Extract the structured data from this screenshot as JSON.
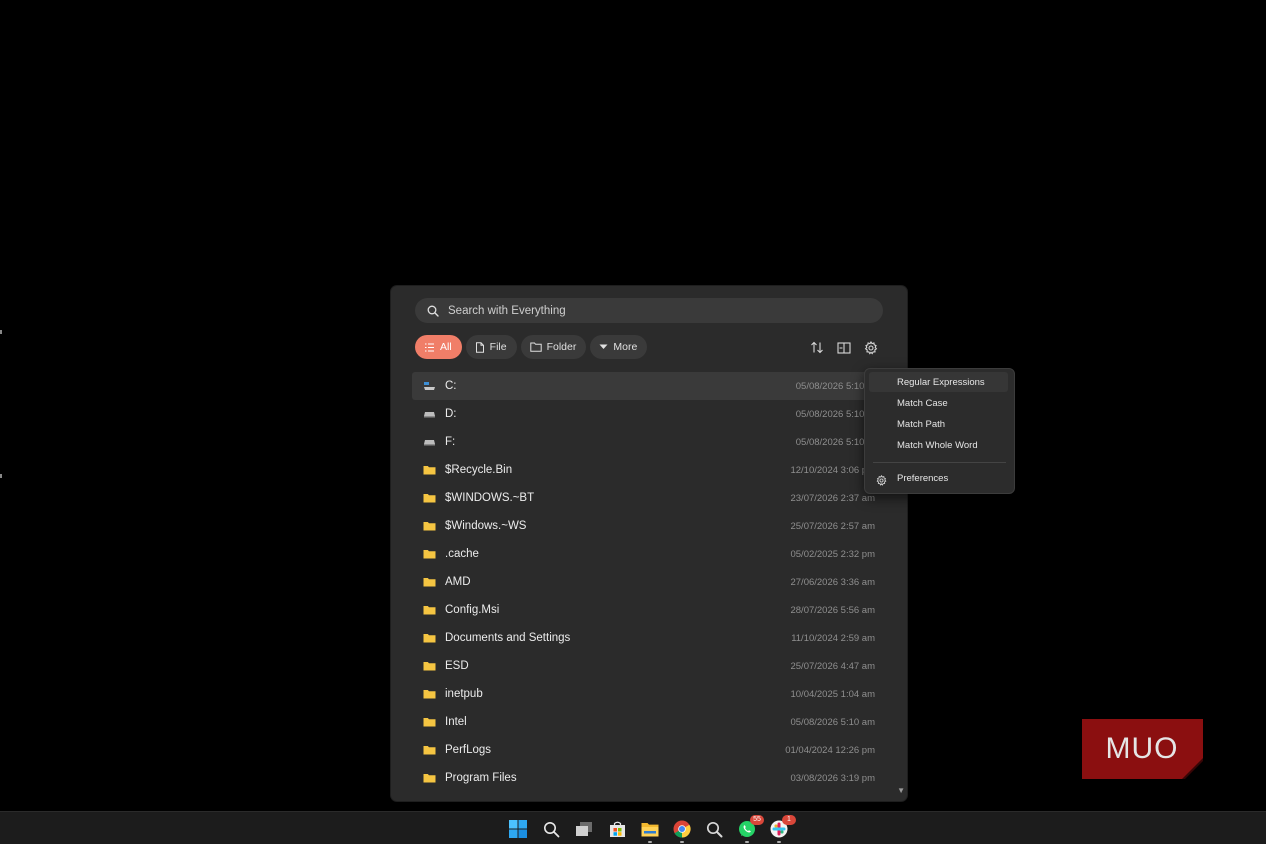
{
  "search": {
    "placeholder": "Search with Everything"
  },
  "filters": [
    {
      "label": "All",
      "active": true
    },
    {
      "label": "File"
    },
    {
      "label": "Folder"
    },
    {
      "label": "More"
    }
  ],
  "results": [
    {
      "name": "C:",
      "date": "05/08/2026 5:10 ...",
      "icon": "drive-icon",
      "selected": true
    },
    {
      "name": "D:",
      "date": "05/08/2026 5:10 ...",
      "icon": "drive-icon"
    },
    {
      "name": "F:",
      "date": "05/08/2026 5:10 ...",
      "icon": "drive-icon"
    },
    {
      "name": "$Recycle.Bin",
      "date": "12/10/2024 3:06 p...",
      "icon": "folder-icon"
    },
    {
      "name": "$WINDOWS.~BT",
      "date": "23/07/2026 2:37 am",
      "icon": "folder-icon"
    },
    {
      "name": "$Windows.~WS",
      "date": "25/07/2026 2:57 am",
      "icon": "folder-icon"
    },
    {
      "name": ".cache",
      "date": "05/02/2025 2:32 pm",
      "icon": "folder-icon"
    },
    {
      "name": "AMD",
      "date": "27/06/2026 3:36 am",
      "icon": "folder-icon"
    },
    {
      "name": "Config.Msi",
      "date": "28/07/2026 5:56 am",
      "icon": "folder-icon"
    },
    {
      "name": "Documents and Settings",
      "date": "11/10/2024 2:59 am",
      "icon": "folder-icon"
    },
    {
      "name": "ESD",
      "date": "25/07/2026 4:47 am",
      "icon": "folder-icon"
    },
    {
      "name": "inetpub",
      "date": "10/04/2025 1:04 am",
      "icon": "folder-icon"
    },
    {
      "name": "Intel",
      "date": "05/08/2026 5:10 am",
      "icon": "folder-icon"
    },
    {
      "name": "PerfLogs",
      "date": "01/04/2024 12:26 pm",
      "icon": "folder-icon"
    },
    {
      "name": "Program Files",
      "date": "03/08/2026 3:19 pm",
      "icon": "folder-icon"
    }
  ],
  "menu": {
    "items": [
      "Regular Expressions",
      "Match Case",
      "Match Path",
      "Match Whole Word"
    ],
    "preferences": "Preferences"
  },
  "logo": {
    "text": "MUO"
  },
  "taskbar": {
    "whatsapp_badge": "55",
    "slack_badge": "1"
  },
  "colors": {
    "accent": "#f07e68",
    "window_bg": "#2b2b2b",
    "folder": "#f5c542",
    "logo_red": "#8b0f10"
  }
}
